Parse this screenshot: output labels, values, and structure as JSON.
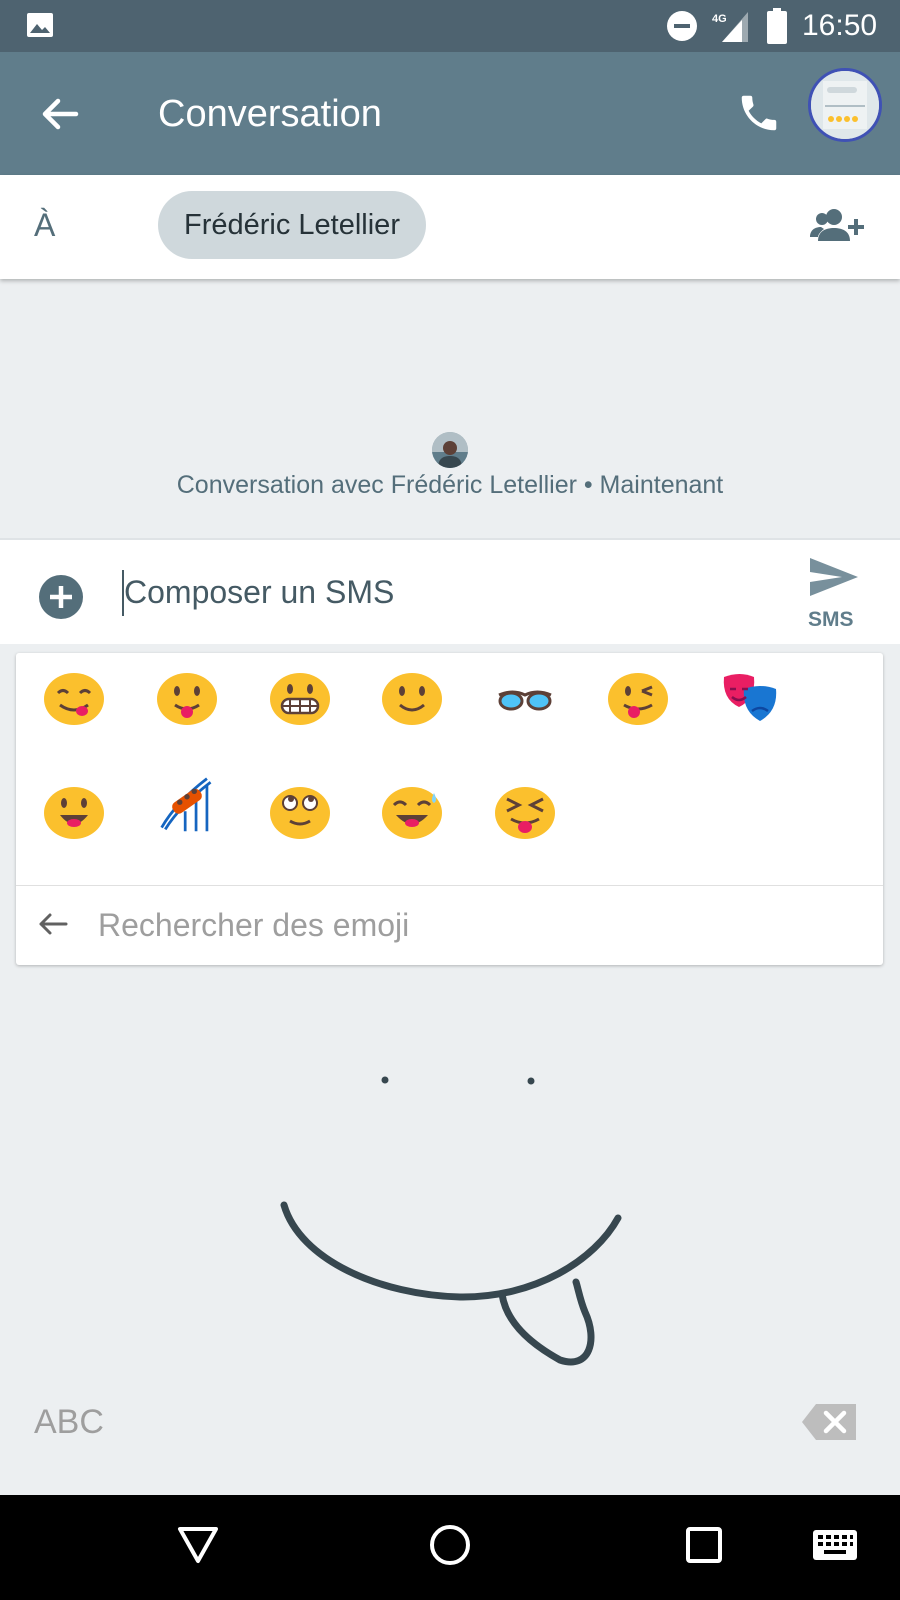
{
  "status_bar": {
    "time": "16:50",
    "network": "4G",
    "icons": [
      "gallery-icon",
      "do-not-disturb-icon",
      "signal-icon",
      "battery-icon"
    ]
  },
  "app_bar": {
    "title": "Conversation",
    "icons": [
      "back-arrow-icon",
      "phone-icon",
      "avatar"
    ]
  },
  "recipient": {
    "to_label": "À",
    "chip": "Frédéric Letellier"
  },
  "conversation": {
    "info": "Conversation avec Frédéric Letellier • Maintenant"
  },
  "compose": {
    "placeholder": "Composer un SMS",
    "send_label": "SMS"
  },
  "emoji_panel": {
    "row1": [
      "yum-face",
      "tongue-face",
      "grinning-face",
      "smile-face",
      "sunglasses",
      "wink-tongue-face",
      "performing-arts"
    ],
    "row2": [
      "open-mouth-face",
      "roller-coaster",
      "rolling-eyes-face",
      "sweat-smile-face",
      "squint-tongue-face"
    ],
    "search_placeholder": "Rechercher des emoji"
  },
  "keyboard": {
    "abc_label": "ABC"
  },
  "colors": {
    "status_bar": "#4e6370",
    "app_bar": "#607d8b",
    "background": "#eceff1",
    "chip": "#cfd8dc",
    "ink": "#37474f",
    "emoji_yellow": "#fbc02d"
  }
}
